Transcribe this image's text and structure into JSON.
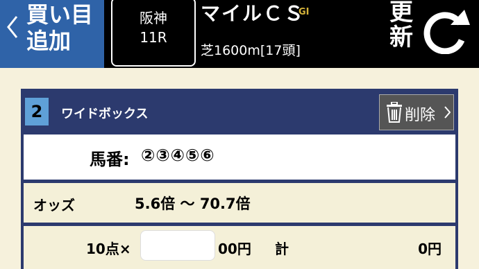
{
  "header": {
    "back_label": "買い目\n追加",
    "race": {
      "venue": "阪神",
      "number": "11R"
    },
    "race_name": "マイルＣＳ",
    "grade": "GI",
    "race_meta": "芝1600m[17頭]",
    "refresh_label": "更\n新"
  },
  "bet_card": {
    "index": "2",
    "bet_type": "ワイドボックス",
    "delete_label": "削除",
    "horses_label": "馬番:",
    "horses_value": "②③④⑤⑥",
    "odds_label": "オッズ",
    "odds_value": "5.6倍 〜 70.7倍",
    "points": "10点×",
    "amount_value": "",
    "amount_unit": "00円",
    "total_label": "計",
    "total_value": "0円"
  },
  "colors": {
    "header_bg": "#000000",
    "back_button_bg": "#2f63a8",
    "card_bg": "#2c3a6e",
    "index_badge": "#5fa0d8",
    "grade": "#d4b23a",
    "page_bg": "#f6f1dc"
  }
}
